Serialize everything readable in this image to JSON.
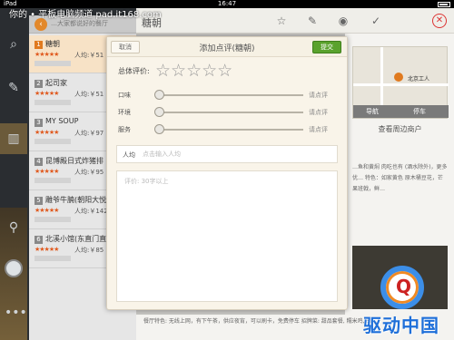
{
  "status_bar": {
    "carrier": "iPad",
    "time": "16:47"
  },
  "watermark": "你的 • 平板电脑频道 pad.it168.com",
  "list": {
    "header_text": "…大家都说好的餐厅",
    "items": [
      {
        "num": "1",
        "name": "糖朝",
        "price": "人均:￥51"
      },
      {
        "num": "2",
        "name": "起司家",
        "price": "人均:￥51"
      },
      {
        "num": "3",
        "name": "MY SOUP",
        "price": "人均:￥97"
      },
      {
        "num": "4",
        "name": "昆博殿日式炸猪排",
        "price": "人均:￥95"
      },
      {
        "num": "5",
        "name": "雕爷牛腩(朝阳大悦城)",
        "price": "人均:￥142"
      },
      {
        "num": "6",
        "name": "北溪小馆(东直门直营店)",
        "price": "人均:￥85"
      }
    ]
  },
  "detail": {
    "title": "糖朝",
    "map_label": "北京工人",
    "map_buttons": [
      "导航",
      "停车"
    ],
    "nearby": "查看周边商户",
    "text": "…鱼和黄焖 肉吃也有 (酒水除外)，更多优…  特色：如家黄色 原木桶豆花，芒果班戟，鲜…",
    "bottom_text": "餐厅特色: 无线上网，有下午茶，供应夜宵，可以刷卡，免费停车 招牌菜: 甜品套餐, 糯米鸡, 肉…"
  },
  "modal": {
    "cancel": "取消",
    "title": "添加点评(糖朝)",
    "submit": "提交",
    "overall_label": "总体评价:",
    "overall_stars": "☆☆☆☆☆",
    "sliders": [
      {
        "label": "口味",
        "hint": "请点评"
      },
      {
        "label": "环境",
        "hint": "请点评"
      },
      {
        "label": "服务",
        "hint": "请点评"
      }
    ],
    "avg_label": "人均",
    "avg_placeholder": "点击输入人均",
    "comment_placeholder": "评价: 30字以上"
  },
  "logo": {
    "text": "驱动中国",
    "letter": "Q"
  },
  "colors": {
    "accent": "#e07a1f",
    "submit": "#5aa22d",
    "logo_blue": "#1e6fd9"
  }
}
